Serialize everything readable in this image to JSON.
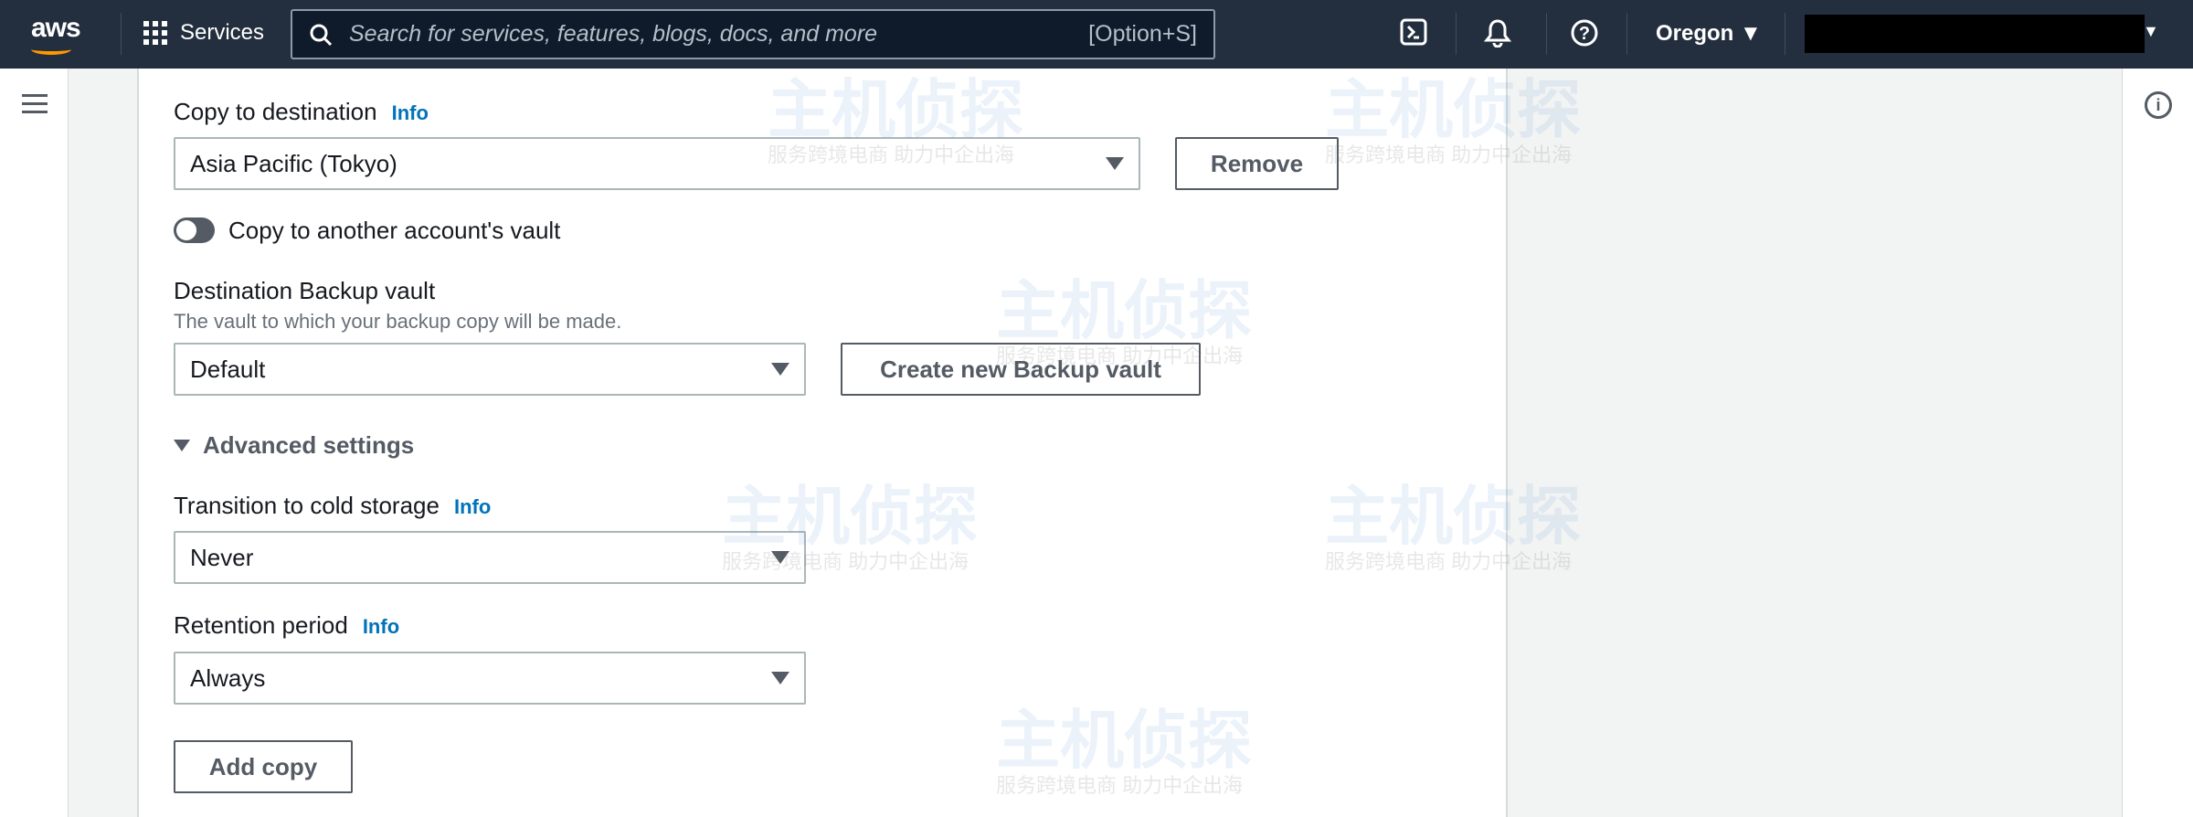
{
  "nav": {
    "logo": "aws",
    "services_label": "Services",
    "search_placeholder": "Search for services, features, blogs, docs, and more",
    "search_shortcut": "[Option+S]",
    "region": "Oregon ▼",
    "account_caret": "▼"
  },
  "form": {
    "copy_destination_label": "Copy to destination",
    "info": "Info",
    "copy_destination_value": "Asia Pacific (Tokyo)",
    "remove_button": "Remove",
    "toggle_label": "Copy to another account's vault",
    "toggle_on": false,
    "vault_label": "Destination Backup vault",
    "vault_desc": "The vault to which your backup copy will be made.",
    "vault_value": "Default",
    "create_vault_button": "Create new Backup vault",
    "advanced_label": "Advanced settings",
    "cold_label": "Transition to cold storage",
    "cold_value": "Never",
    "retention_label": "Retention period",
    "retention_value": "Always",
    "add_copy_button": "Add copy"
  },
  "watermark": {
    "title": "主机侦探",
    "subtitle": "服务跨境电商 助力中企出海"
  }
}
